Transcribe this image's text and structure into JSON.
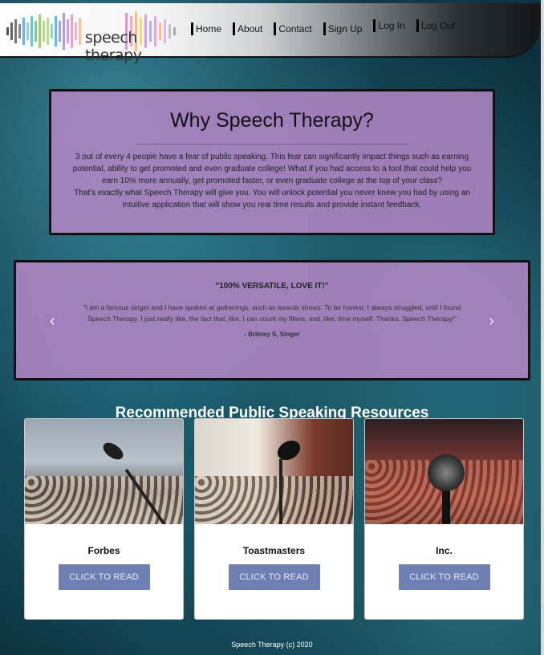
{
  "header": {
    "logo_text": "speech therapy",
    "nav": [
      "Home",
      "About",
      "Contact",
      "Sign Up",
      "Log In",
      "Log Out"
    ]
  },
  "why": {
    "title": "Why Speech Therapy?",
    "paragraph1": "3 out of every 4 people have a fear of public speaking. This fear can significantly impact things such as earning potential, ability to get promoted and even graduate college! What if you had access to a tool that could help you earn 10% more annually, get promoted faster, or even graduate college at the top of your class?",
    "paragraph2": "That's exactly what Speech Therapy will give you. You will unlock potential you never knew you had by using an intuitive application that will show you real time results and provide instant feedback."
  },
  "testimonial": {
    "title": "\"100% VERSATILE, LOVE IT!\"",
    "quote": "\"I am a famous singer and I have spoken at gatherings, such as awards shows. To be honest, I always struggled, until I found Speech Therapy. I just really like, the fact that, like, I can count my fillers, and, like, time myself. Thanks, Speech Therapy!\"",
    "author": "- Britney S, Singer",
    "prev_icon": "‹",
    "next_icon": "›"
  },
  "resources": {
    "heading": "Recommended Public Speaking Resources",
    "cards": [
      {
        "title": "Forbes",
        "button": "CLICK TO READ"
      },
      {
        "title": "Toastmasters",
        "button": "CLICK TO READ"
      },
      {
        "title": "Inc.",
        "button": "CLICK TO READ"
      }
    ]
  },
  "footer": {
    "text": "Speech Therapy (c) 2020"
  },
  "colors": {
    "panel": "#b084c4",
    "button": "#6e7fb3",
    "header_dark": "#121619"
  }
}
